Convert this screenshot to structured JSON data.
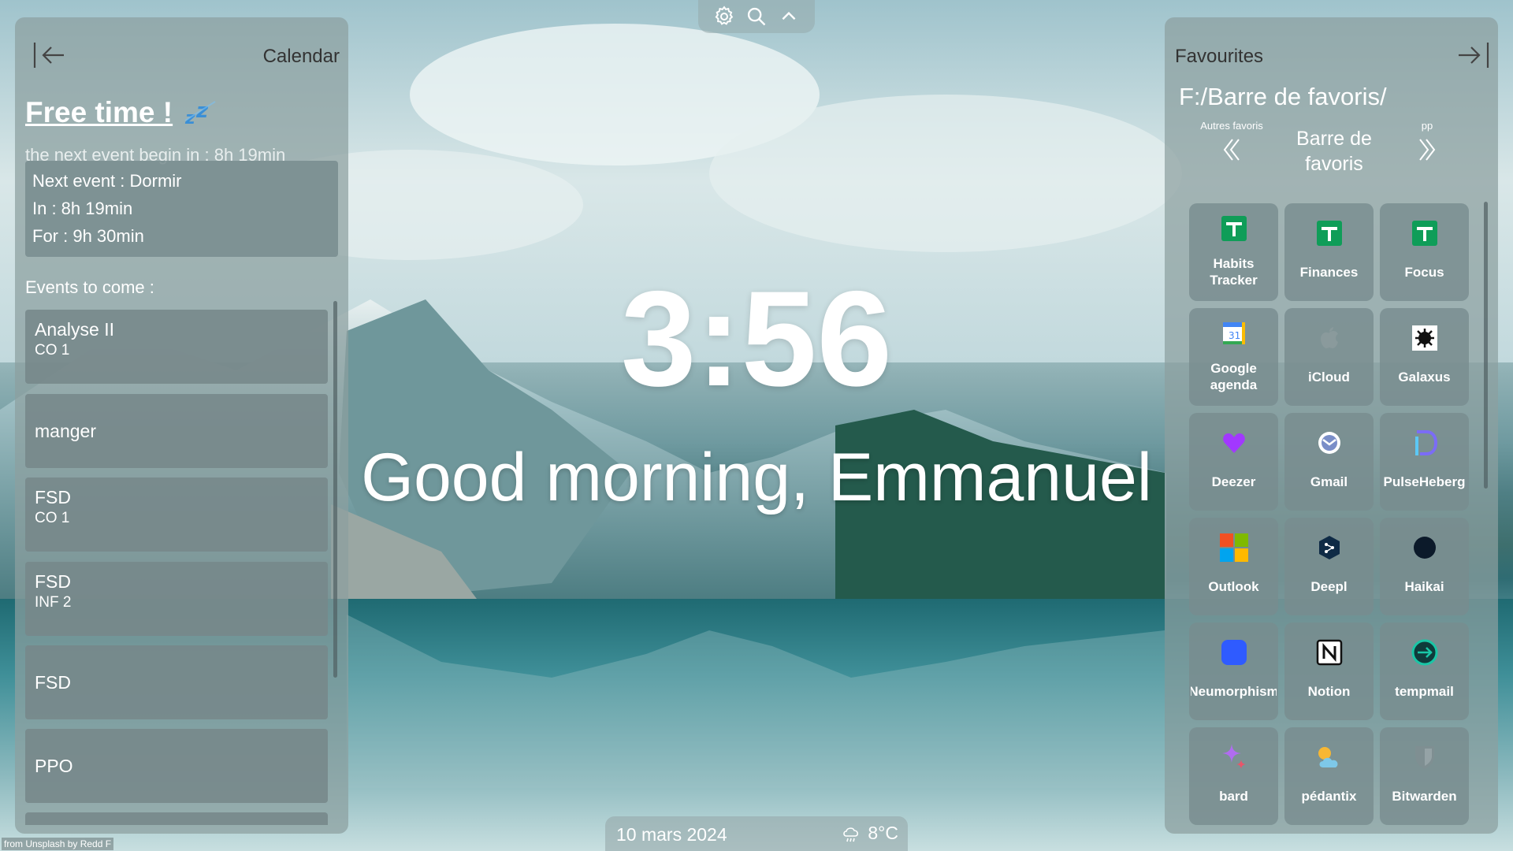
{
  "topbar": {
    "icons": [
      "gear-icon",
      "search-icon",
      "chevron-up-icon"
    ]
  },
  "calendar": {
    "title": "Calendar",
    "free_title": "Free time !",
    "next_begin": "the next event begin in : 8h 19min",
    "next_event": {
      "line1": "Next event : Dormir",
      "line2": "In : 8h 19min",
      "line3": "For : 9h 30min"
    },
    "events_title": "Events to come :",
    "events": [
      {
        "name": "Analyse II",
        "room": "CO 1"
      },
      {
        "name": "manger",
        "room": ""
      },
      {
        "name": "FSD",
        "room": "CO 1"
      },
      {
        "name": "FSD",
        "room": "INF 2"
      },
      {
        "name": "FSD",
        "room": ""
      },
      {
        "name": "PPO",
        "room": ""
      }
    ]
  },
  "clock": {
    "time": "3:56"
  },
  "greeting": "Good morning, Emmanuel",
  "bottom": {
    "date": "10 mars 2024",
    "temperature": "8°C"
  },
  "credit": "from Unsplash by Redd F",
  "favourites": {
    "title": "Favourites",
    "path": "F:/Barre de favoris/",
    "prev_label": "Autres favoris",
    "current_folder": "Barre de favoris",
    "next_label": "pp",
    "items": [
      {
        "name": "Habits Tracker",
        "icon": "sheets-icon"
      },
      {
        "name": "Finances",
        "icon": "sheets-icon"
      },
      {
        "name": "Focus",
        "icon": "sheets-icon"
      },
      {
        "name": "Google agenda",
        "icon": "google-calendar-icon"
      },
      {
        "name": "iCloud",
        "icon": "apple-icon"
      },
      {
        "name": "Galaxus",
        "icon": "galaxus-icon"
      },
      {
        "name": "Deezer",
        "icon": "heart-icon"
      },
      {
        "name": "Gmail",
        "icon": "gmail-icon"
      },
      {
        "name": "PulseHeberg",
        "icon": "pulseheberg-icon"
      },
      {
        "name": "Outlook",
        "icon": "microsoft-icon"
      },
      {
        "name": "Deepl",
        "icon": "deepl-icon"
      },
      {
        "name": "Haikai",
        "icon": "dot-icon"
      },
      {
        "name": "Neumorphism",
        "icon": "square-icon"
      },
      {
        "name": "Notion",
        "icon": "notion-icon"
      },
      {
        "name": "tempmail",
        "icon": "tempmail-icon"
      },
      {
        "name": "bard",
        "icon": "sparkle-icon"
      },
      {
        "name": "pédantix",
        "icon": "weather-icon"
      },
      {
        "name": "Bitwarden",
        "icon": "shield-icon"
      }
    ]
  },
  "colors": {
    "panel": "#8ca0a0",
    "accent_sheets": "#0f9d58",
    "deezer": "#a238ff",
    "neumorphism": "#2f5bff"
  }
}
